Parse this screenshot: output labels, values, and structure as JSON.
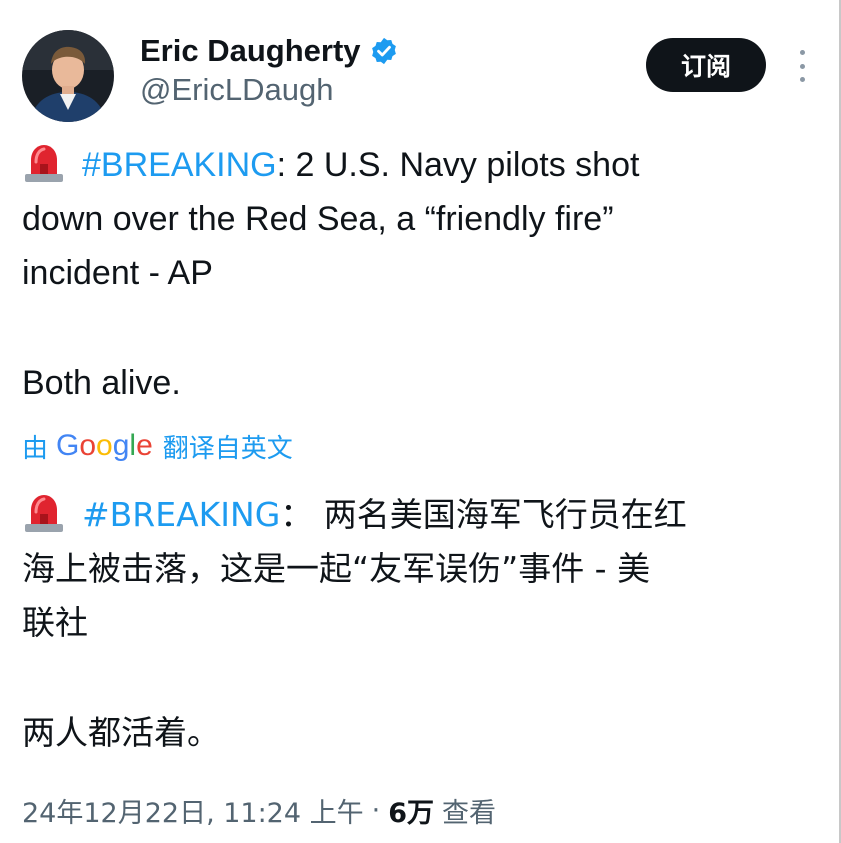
{
  "author": {
    "display_name": "Eric Daugherty",
    "handle": "@EricLDaugh",
    "verified": true,
    "verified_color": "#1d9bf0"
  },
  "actions": {
    "subscribe_label": "订阅",
    "more_icon": "more-vertical-icon"
  },
  "tweet": {
    "emoji": "rotating-light-icon",
    "hashtag": "#BREAKING",
    "en_line1_rest": ": 2 U.S. Navy pilots shot",
    "en_line2": "down over the Red Sea, a “friendly fire”",
    "en_line3": "incident - AP",
    "en_para2": "Both alive."
  },
  "translation": {
    "prefix": "由",
    "google": "Google",
    "suffix": "翻译自英文",
    "hashtag": "#BREAKING",
    "zh_line1_rest": "： 两名美国海军飞行员在红",
    "zh_line2": "海上被击落，这是一起“友军误伤”事件 - 美",
    "zh_line3": "联社",
    "zh_para2": "两人都活着。"
  },
  "meta": {
    "timestamp": "24年12月22日, 11:24 上午",
    "separator": "·",
    "views_count": "6万",
    "views_label": "查看"
  },
  "colors": {
    "link": "#1d9bf0",
    "text": "#0f1419",
    "secondary": "#536471",
    "button_bg": "#0f1419"
  }
}
